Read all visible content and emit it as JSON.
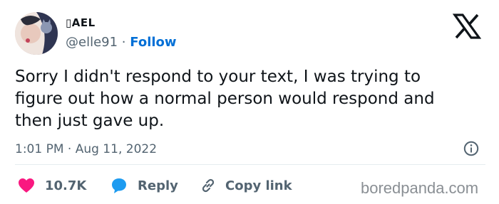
{
  "tweet": {
    "display_name": "▯AEL",
    "handle": "@elle91",
    "separator": "·",
    "follow_label": "Follow",
    "text": "Sorry I didn't respond to your text, I was trying to\nfigure out how a normal person would respond and\nthen just gave up.",
    "timestamp": "1:01 PM · Aug 11, 2022"
  },
  "actions": {
    "like_count": "10.7K",
    "reply_label": "Reply",
    "copy_label": "Copy link"
  },
  "watermark": "boredpanda.com",
  "colors": {
    "accent": "#006fd6",
    "like": "#f91880",
    "text": "#0f1419",
    "muted": "#536471"
  },
  "icons": [
    "x-logo-icon",
    "info-icon",
    "heart-icon",
    "reply-bubble-icon",
    "link-icon"
  ]
}
